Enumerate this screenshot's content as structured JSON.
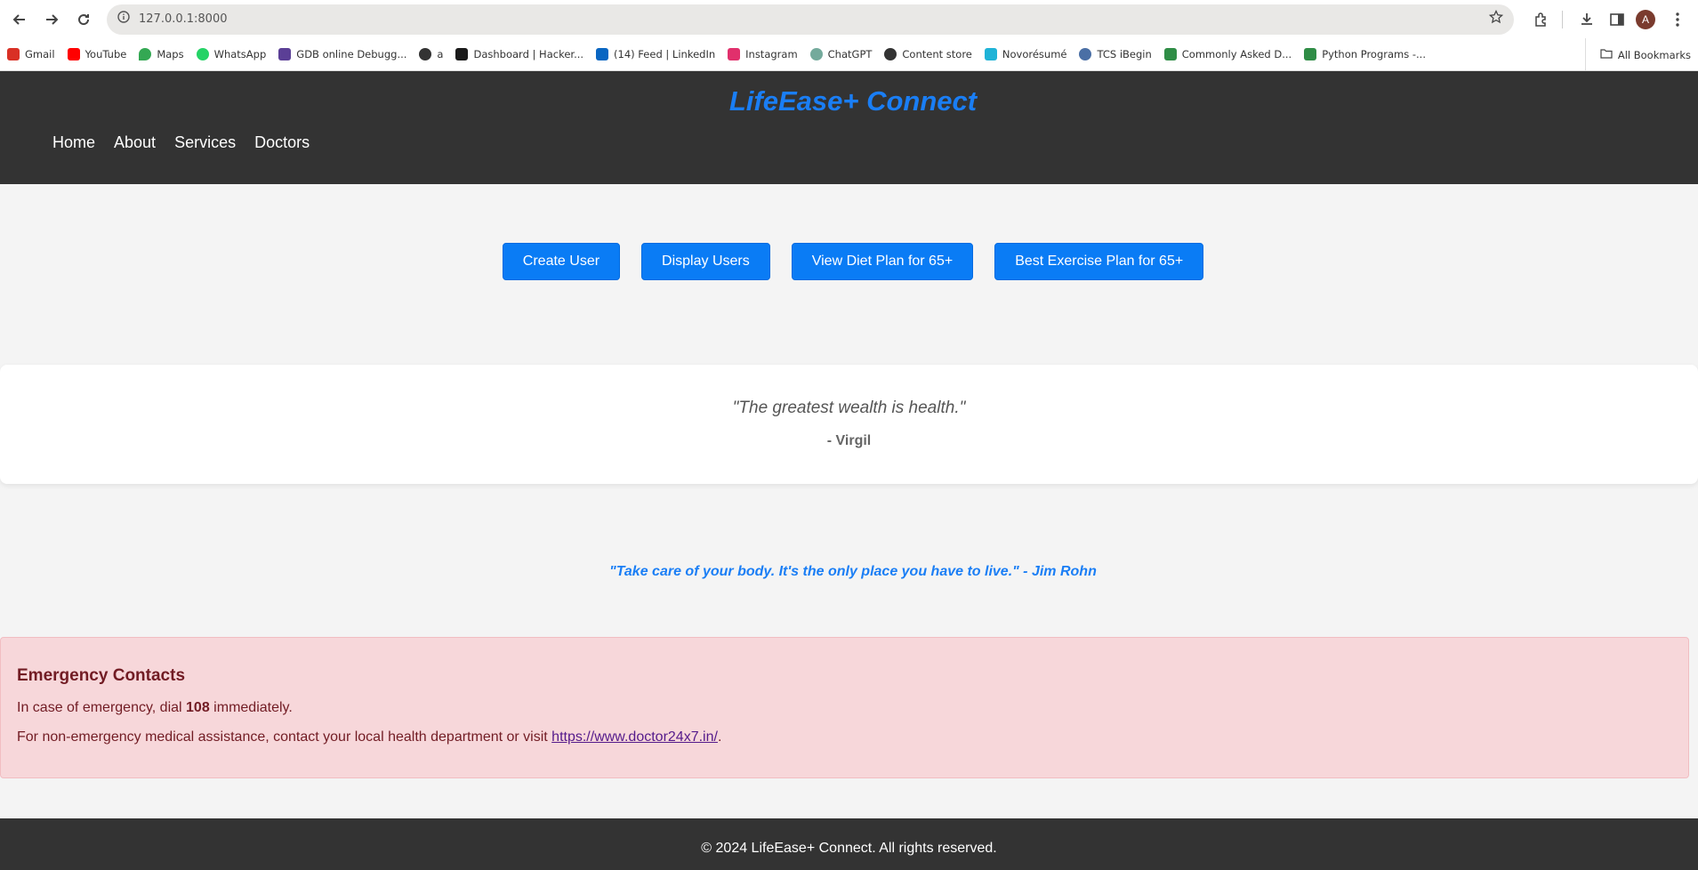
{
  "browser": {
    "url": "127.0.0.1:8000",
    "avatar_letter": "A",
    "bookmarks": [
      {
        "label": "Gmail",
        "color": "#d93025"
      },
      {
        "label": "YouTube",
        "color": "#ff0000"
      },
      {
        "label": "Maps",
        "color": "#34a853"
      },
      {
        "label": "WhatsApp",
        "color": "#25d366"
      },
      {
        "label": "GDB online Debugg...",
        "color": "#5b3f96"
      },
      {
        "label": "a",
        "color": "#333333"
      },
      {
        "label": "Dashboard | Hacker...",
        "color": "#1a1a1a"
      },
      {
        "label": "(14) Feed | LinkedIn",
        "color": "#0a66c2"
      },
      {
        "label": "Instagram",
        "color": "#e1306c"
      },
      {
        "label": "ChatGPT",
        "color": "#74aa9c"
      },
      {
        "label": "Content store",
        "color": "#333333"
      },
      {
        "label": "Novorésumé",
        "color": "#1fb3d7"
      },
      {
        "label": "TCS iBegin",
        "color": "#4a6fa5"
      },
      {
        "label": "Commonly Asked D...",
        "color": "#2f8d46"
      },
      {
        "label": "Python Programs -...",
        "color": "#2f8d46"
      }
    ],
    "all_bookmarks": "All Bookmarks"
  },
  "header": {
    "brand": "LifeEase+ Connect",
    "nav": [
      "Home",
      "About",
      "Services",
      "Doctors"
    ]
  },
  "actions": [
    "Create User",
    "Display Users",
    "View Diet Plan for 65+",
    "Best Exercise Plan for 65+"
  ],
  "quote": {
    "text": "\"The greatest wealth is health.\"",
    "author": "- Virgil"
  },
  "quote2": "\"Take care of your body. It's the only place you have to live.\" - Jim Rohn",
  "emergency": {
    "title": "Emergency Contacts",
    "line1_pre": "In case of emergency, dial ",
    "line1_number": "108",
    "line1_post": " immediately.",
    "line2_pre": "For non-emergency medical assistance, contact your local health department or visit ",
    "line2_link": "https://www.doctor24x7.in/",
    "line2_post": "."
  },
  "footer": "© 2024 LifeEase+ Connect. All rights reserved.",
  "colors": {
    "accent": "#0a7cf5",
    "header_bg": "#333333",
    "emergency_bg": "#f7d7da"
  }
}
